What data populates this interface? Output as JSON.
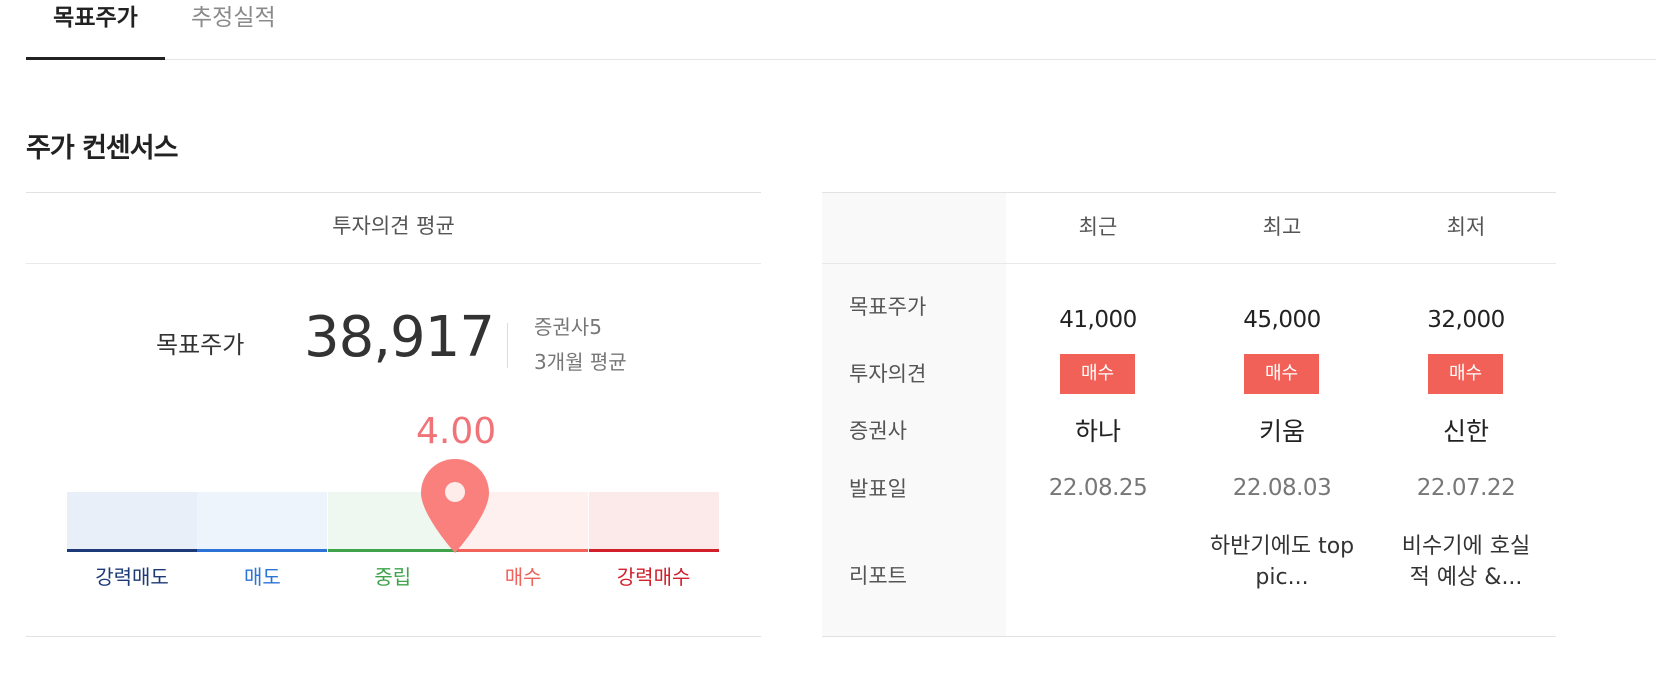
{
  "tabs": {
    "active": "목표주가",
    "inactive": "추정실적"
  },
  "section_title": "주가 컨센서스",
  "opinion": {
    "header": "투자의견 평균",
    "target_label": "목표주가",
    "target_value": "38,917",
    "broker_count": "증권사5",
    "period": "3개월 평균",
    "score": "4.00",
    "score_numeric": 4.0,
    "scale": [
      {
        "label": "강력매도",
        "color": "#1c3a78",
        "bg": "#e9eff8"
      },
      {
        "label": "매도",
        "color": "#2b73d6",
        "bg": "#eef4fc"
      },
      {
        "label": "중립",
        "color": "#3ea34b",
        "bg": "#eef8f1"
      },
      {
        "label": "매수",
        "color": "#f0625a",
        "bg": "#fdf0ef"
      },
      {
        "label": "강력매수",
        "color": "#d1202b",
        "bg": "#fce9ea"
      }
    ],
    "pin_color": "#f9807c"
  },
  "table": {
    "columns": [
      "최근",
      "최고",
      "최저"
    ],
    "rows": {
      "target_price": "목표주가",
      "opinion": "투자의견",
      "broker": "증권사",
      "date": "발표일",
      "report": "리포트"
    },
    "data": [
      {
        "price": "41,000",
        "opinion": "매수",
        "broker": "하나",
        "date": "22.08.25",
        "report_line1": "",
        "report_line2": ""
      },
      {
        "price": "45,000",
        "opinion": "매수",
        "broker": "키움",
        "date": "22.08.03",
        "report_line1": "하반기에도 top",
        "report_line2": "pic..."
      },
      {
        "price": "32,000",
        "opinion": "매수",
        "broker": "신한",
        "date": "22.07.22",
        "report_line1": "비수기에 호실",
        "report_line2": "적 예상 &..."
      }
    ]
  }
}
